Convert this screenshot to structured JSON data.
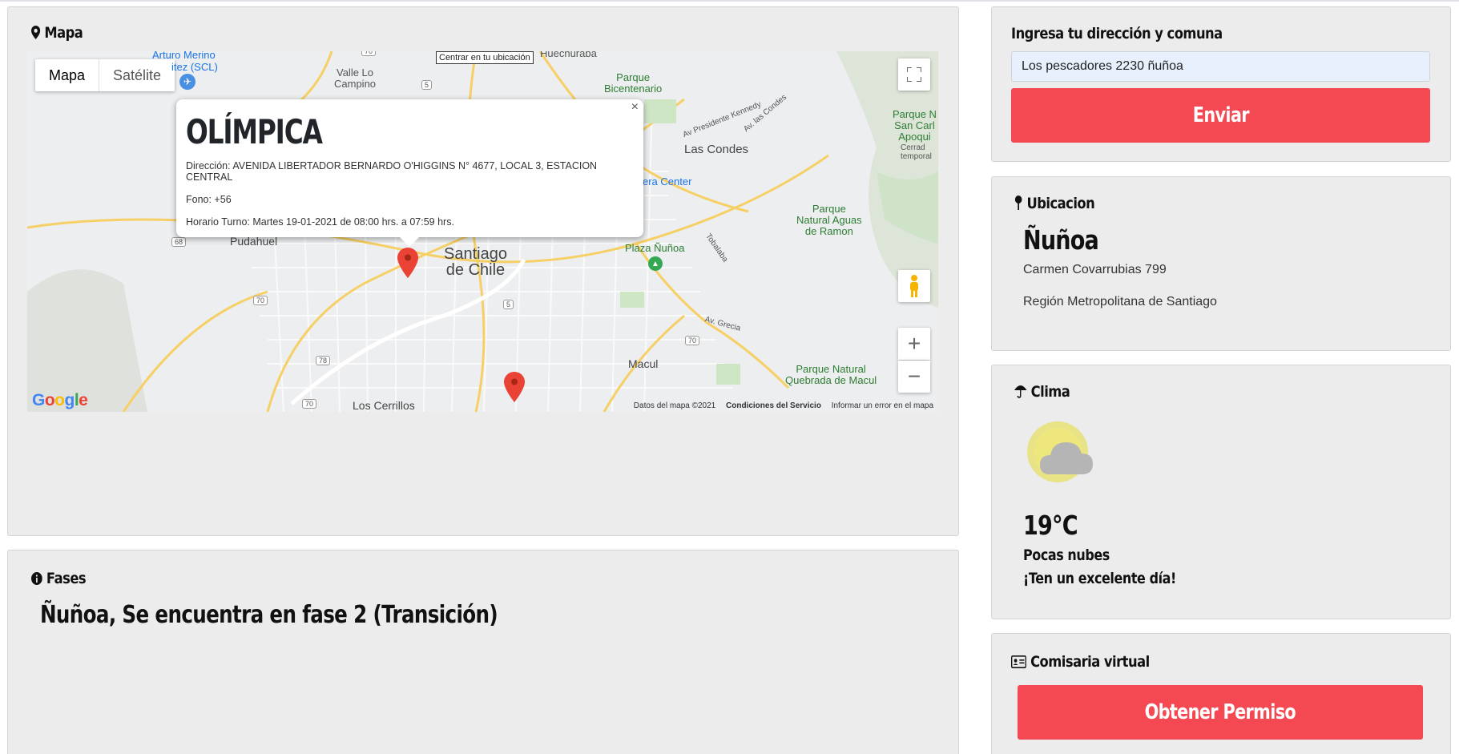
{
  "map_panel": {
    "title": "Mapa",
    "map_type_options": [
      "Mapa",
      "Satélite"
    ],
    "center_button": "Centrar en tu ubicación",
    "place_labels": {
      "arturo_merino": "Arturo Merino",
      "scl": "itez (SCL)",
      "valle_lo_campino": "Valle Lo\nCampino",
      "huechuraba": "Huechuraba",
      "parque_bicentenario": "Parque\nBicentenario",
      "av_presidente_kennedy": "Av Presidente Kennedy",
      "av_las_condes": "Av. las Condes",
      "las_condes": "Las Condes",
      "parque_san_carlos": "Parque N\nSan Carl\nApoqui",
      "cerrado": "Cerrad\ntemporal",
      "costanera_center": "era Center",
      "pudahuel": "Pudahuel",
      "santiago": "Santiago\nde Chile",
      "plaza_nunoa": "Plaza Ñuñoa",
      "tobalaba": "Tobalaba",
      "parque_aguas_ramon": "Parque\nNatural Aguas\nde Ramon",
      "av_grecia": "Av. Grecia",
      "macul": "Macul",
      "parque_quebrada": "Parque Natural\nQuebrada de Macul",
      "los_cerrillos": "Los Cerrillos"
    },
    "route_shields": [
      "70",
      "5",
      "68",
      "70",
      "5",
      "78",
      "70",
      "70"
    ],
    "info_window": {
      "name": "OLÍMPICA",
      "address": "Dirección: AVENIDA LIBERTADOR BERNARDO O'HIGGINS N° 4677, LOCAL 3, ESTACION CENTRAL",
      "phone": "Fono: +56",
      "schedule": "Horario Turno: Martes 19-01-2021 de 08:00 hrs. a 07:59 hrs.",
      "close": "×"
    },
    "google_logo": "Google",
    "attribution": {
      "data": "Datos del mapa ©2021",
      "terms": "Condiciones del Servicio",
      "report": "Informar un error en el mapa"
    },
    "zoom_in": "+",
    "zoom_out": "−"
  },
  "phases_panel": {
    "title": "Fases",
    "status": "Ñuñoa, Se encuentra en fase 2 (Transición)"
  },
  "address_panel": {
    "title": "Ingresa tu dirección y comuna",
    "input_value": "Los pescadores 2230 ñuñoa",
    "submit_label": "Enviar"
  },
  "location_panel": {
    "title": "Ubicacion",
    "commune": "Ñuñoa",
    "street": "Carmen Covarrubias 799",
    "region": "Región Metropolitana de Santiago"
  },
  "weather_panel": {
    "title": "Clima",
    "temperature": "19°C",
    "condition": "Pocas nubes",
    "message": "¡Ten un excelente día!"
  },
  "police_panel": {
    "title": "Comisaria virtual",
    "button_label": "Obtener Permiso"
  },
  "colors": {
    "accent_red": "#f44853",
    "panel_bg": "#ececec",
    "input_bg": "#e8f0fe",
    "map_pin": "#ea4335"
  }
}
